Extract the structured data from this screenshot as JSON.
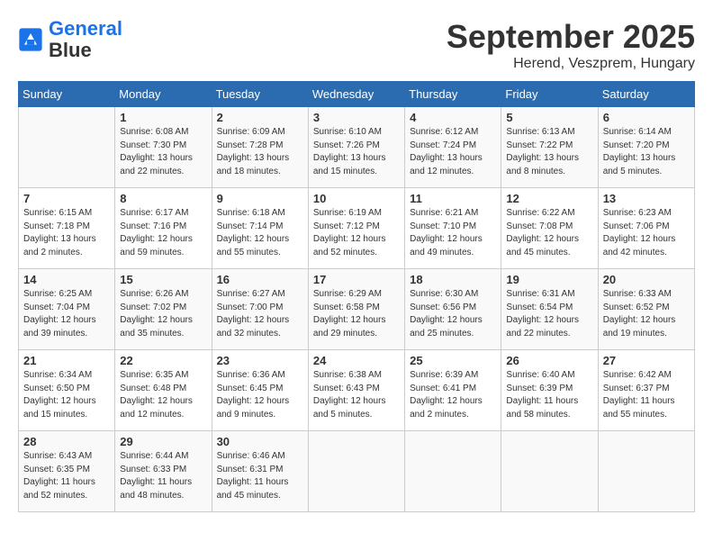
{
  "header": {
    "logo_line1": "General",
    "logo_line2": "Blue",
    "month": "September 2025",
    "location": "Herend, Veszprem, Hungary"
  },
  "weekdays": [
    "Sunday",
    "Monday",
    "Tuesday",
    "Wednesday",
    "Thursday",
    "Friday",
    "Saturday"
  ],
  "weeks": [
    [
      {
        "day": "",
        "info": ""
      },
      {
        "day": "1",
        "info": "Sunrise: 6:08 AM\nSunset: 7:30 PM\nDaylight: 13 hours\nand 22 minutes."
      },
      {
        "day": "2",
        "info": "Sunrise: 6:09 AM\nSunset: 7:28 PM\nDaylight: 13 hours\nand 18 minutes."
      },
      {
        "day": "3",
        "info": "Sunrise: 6:10 AM\nSunset: 7:26 PM\nDaylight: 13 hours\nand 15 minutes."
      },
      {
        "day": "4",
        "info": "Sunrise: 6:12 AM\nSunset: 7:24 PM\nDaylight: 13 hours\nand 12 minutes."
      },
      {
        "day": "5",
        "info": "Sunrise: 6:13 AM\nSunset: 7:22 PM\nDaylight: 13 hours\nand 8 minutes."
      },
      {
        "day": "6",
        "info": "Sunrise: 6:14 AM\nSunset: 7:20 PM\nDaylight: 13 hours\nand 5 minutes."
      }
    ],
    [
      {
        "day": "7",
        "info": "Sunrise: 6:15 AM\nSunset: 7:18 PM\nDaylight: 13 hours\nand 2 minutes."
      },
      {
        "day": "8",
        "info": "Sunrise: 6:17 AM\nSunset: 7:16 PM\nDaylight: 12 hours\nand 59 minutes."
      },
      {
        "day": "9",
        "info": "Sunrise: 6:18 AM\nSunset: 7:14 PM\nDaylight: 12 hours\nand 55 minutes."
      },
      {
        "day": "10",
        "info": "Sunrise: 6:19 AM\nSunset: 7:12 PM\nDaylight: 12 hours\nand 52 minutes."
      },
      {
        "day": "11",
        "info": "Sunrise: 6:21 AM\nSunset: 7:10 PM\nDaylight: 12 hours\nand 49 minutes."
      },
      {
        "day": "12",
        "info": "Sunrise: 6:22 AM\nSunset: 7:08 PM\nDaylight: 12 hours\nand 45 minutes."
      },
      {
        "day": "13",
        "info": "Sunrise: 6:23 AM\nSunset: 7:06 PM\nDaylight: 12 hours\nand 42 minutes."
      }
    ],
    [
      {
        "day": "14",
        "info": "Sunrise: 6:25 AM\nSunset: 7:04 PM\nDaylight: 12 hours\nand 39 minutes."
      },
      {
        "day": "15",
        "info": "Sunrise: 6:26 AM\nSunset: 7:02 PM\nDaylight: 12 hours\nand 35 minutes."
      },
      {
        "day": "16",
        "info": "Sunrise: 6:27 AM\nSunset: 7:00 PM\nDaylight: 12 hours\nand 32 minutes."
      },
      {
        "day": "17",
        "info": "Sunrise: 6:29 AM\nSunset: 6:58 PM\nDaylight: 12 hours\nand 29 minutes."
      },
      {
        "day": "18",
        "info": "Sunrise: 6:30 AM\nSunset: 6:56 PM\nDaylight: 12 hours\nand 25 minutes."
      },
      {
        "day": "19",
        "info": "Sunrise: 6:31 AM\nSunset: 6:54 PM\nDaylight: 12 hours\nand 22 minutes."
      },
      {
        "day": "20",
        "info": "Sunrise: 6:33 AM\nSunset: 6:52 PM\nDaylight: 12 hours\nand 19 minutes."
      }
    ],
    [
      {
        "day": "21",
        "info": "Sunrise: 6:34 AM\nSunset: 6:50 PM\nDaylight: 12 hours\nand 15 minutes."
      },
      {
        "day": "22",
        "info": "Sunrise: 6:35 AM\nSunset: 6:48 PM\nDaylight: 12 hours\nand 12 minutes."
      },
      {
        "day": "23",
        "info": "Sunrise: 6:36 AM\nSunset: 6:45 PM\nDaylight: 12 hours\nand 9 minutes."
      },
      {
        "day": "24",
        "info": "Sunrise: 6:38 AM\nSunset: 6:43 PM\nDaylight: 12 hours\nand 5 minutes."
      },
      {
        "day": "25",
        "info": "Sunrise: 6:39 AM\nSunset: 6:41 PM\nDaylight: 12 hours\nand 2 minutes."
      },
      {
        "day": "26",
        "info": "Sunrise: 6:40 AM\nSunset: 6:39 PM\nDaylight: 11 hours\nand 58 minutes."
      },
      {
        "day": "27",
        "info": "Sunrise: 6:42 AM\nSunset: 6:37 PM\nDaylight: 11 hours\nand 55 minutes."
      }
    ],
    [
      {
        "day": "28",
        "info": "Sunrise: 6:43 AM\nSunset: 6:35 PM\nDaylight: 11 hours\nand 52 minutes."
      },
      {
        "day": "29",
        "info": "Sunrise: 6:44 AM\nSunset: 6:33 PM\nDaylight: 11 hours\nand 48 minutes."
      },
      {
        "day": "30",
        "info": "Sunrise: 6:46 AM\nSunset: 6:31 PM\nDaylight: 11 hours\nand 45 minutes."
      },
      {
        "day": "",
        "info": ""
      },
      {
        "day": "",
        "info": ""
      },
      {
        "day": "",
        "info": ""
      },
      {
        "day": "",
        "info": ""
      }
    ]
  ]
}
